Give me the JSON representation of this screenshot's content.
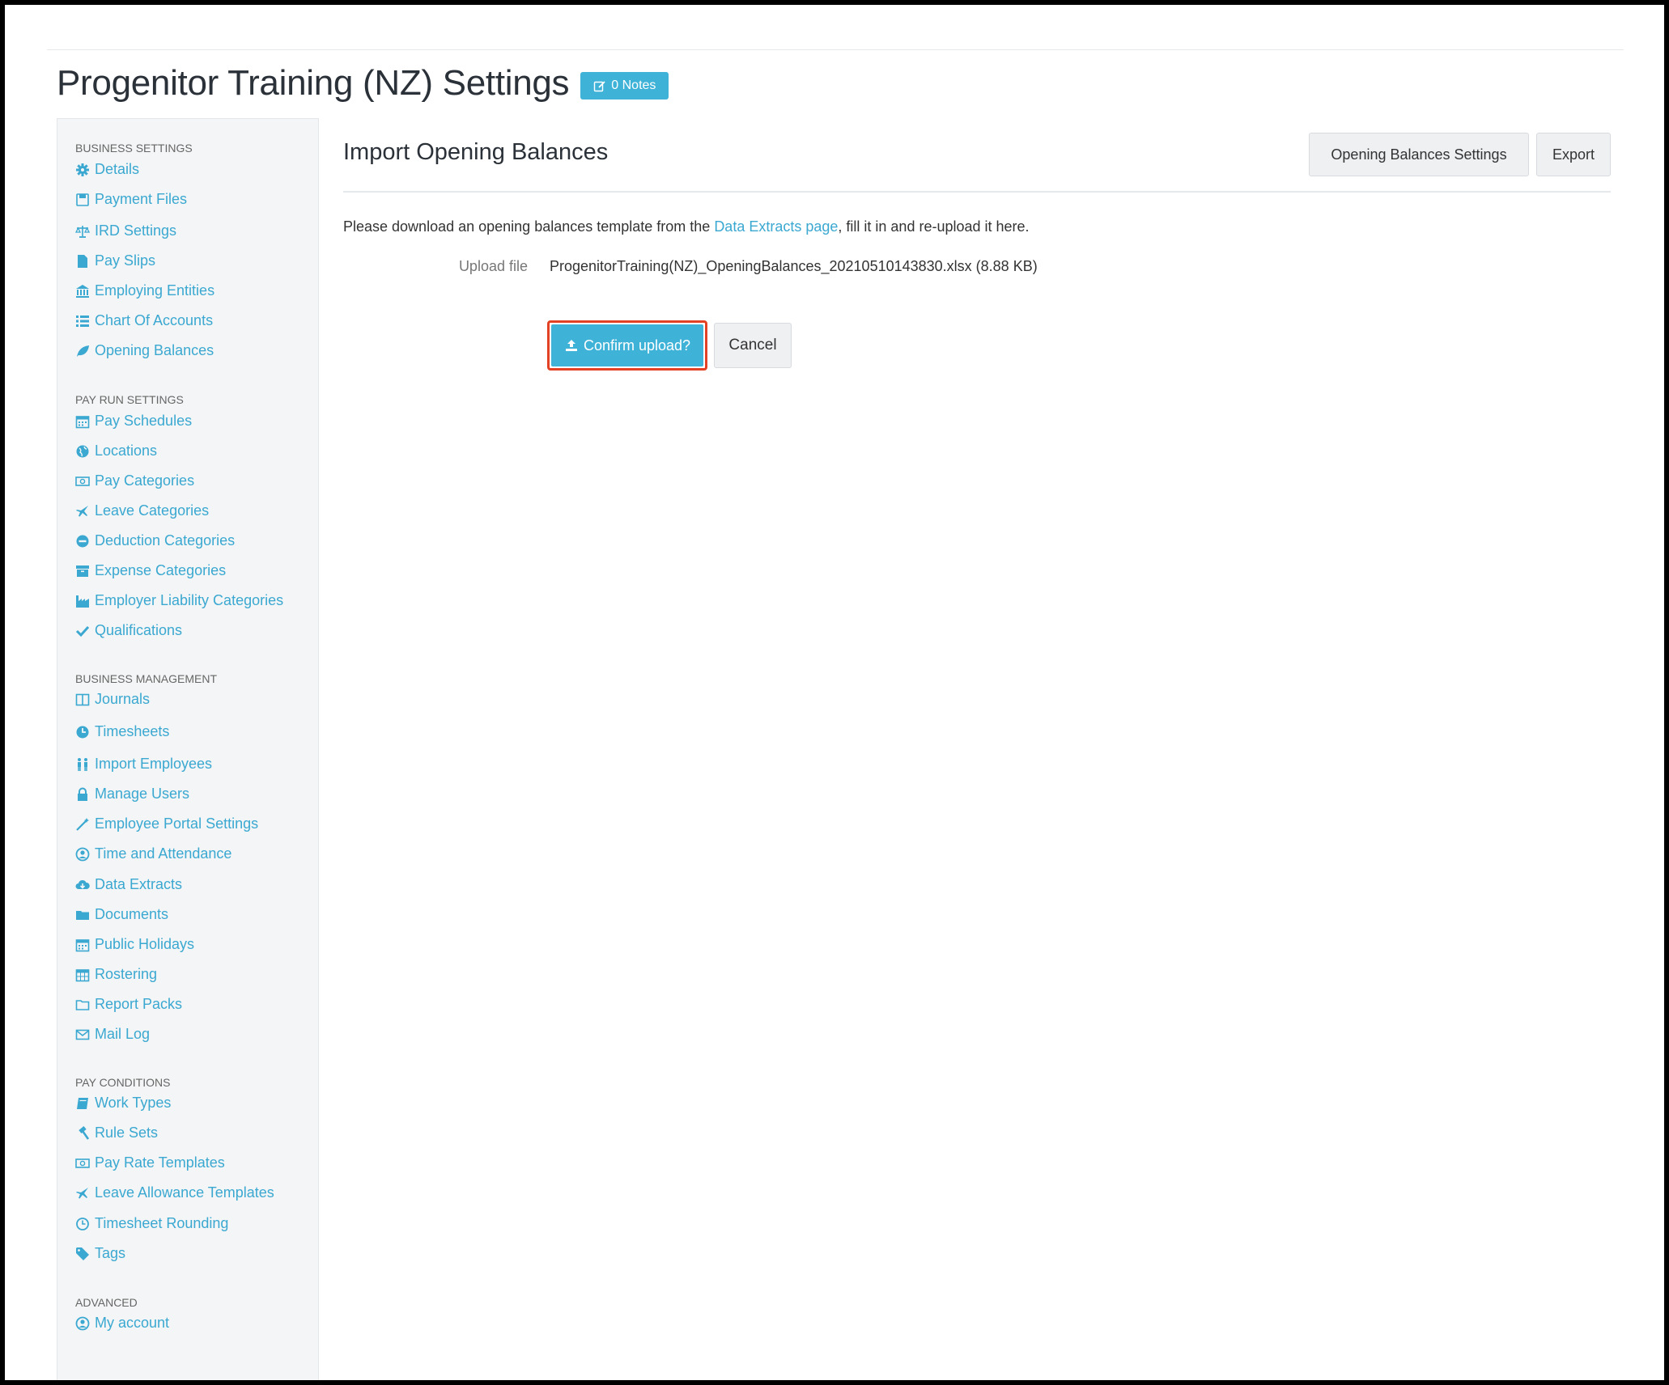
{
  "header": {
    "title": "Progenitor Training (NZ) Settings",
    "notes_label": "0 Notes"
  },
  "sidebar": {
    "business_settings": {
      "heading": "BUSINESS SETTINGS",
      "items": [
        {
          "label": "Details",
          "icon": "gear-icon"
        },
        {
          "label": "Payment Files",
          "icon": "floppy-icon"
        },
        {
          "label": "IRD Settings",
          "icon": "scale-icon"
        },
        {
          "label": "Pay Slips",
          "icon": "file-icon"
        },
        {
          "label": "Employing Entities",
          "icon": "bank-icon"
        },
        {
          "label": "Chart Of Accounts",
          "icon": "list-icon"
        },
        {
          "label": "Opening Balances",
          "icon": "leaf-icon"
        }
      ]
    },
    "pay_run_settings": {
      "heading": "PAY RUN SETTINGS",
      "items": [
        {
          "label": "Pay Schedules",
          "icon": "calendar-icon"
        },
        {
          "label": "Locations",
          "icon": "globe-icon"
        },
        {
          "label": "Pay Categories",
          "icon": "money-icon"
        },
        {
          "label": "Leave Categories",
          "icon": "plane-icon"
        },
        {
          "label": "Deduction Categories",
          "icon": "minus-circle-icon"
        },
        {
          "label": "Expense Categories",
          "icon": "archive-icon"
        },
        {
          "label": "Employer Liability Categories",
          "icon": "industry-icon"
        },
        {
          "label": "Qualifications",
          "icon": "check-icon"
        }
      ]
    },
    "business_management": {
      "heading": "BUSINESS MANAGEMENT",
      "items": [
        {
          "label": "Journals",
          "icon": "columns-icon"
        },
        {
          "label": "Timesheets",
          "icon": "clock-icon"
        },
        {
          "label": "Import Employees",
          "icon": "users-icon"
        },
        {
          "label": "Manage Users",
          "icon": "lock-icon"
        },
        {
          "label": "Employee Portal Settings",
          "icon": "magic-wand-icon"
        },
        {
          "label": "Time and Attendance",
          "icon": "user-circle-icon"
        },
        {
          "label": "Data Extracts",
          "icon": "cloud-download-icon"
        },
        {
          "label": "Documents",
          "icon": "folder-icon"
        },
        {
          "label": "Public Holidays",
          "icon": "calendar-icon"
        },
        {
          "label": "Rostering",
          "icon": "calendar-grid-icon"
        },
        {
          "label": "Report Packs",
          "icon": "folder-outline-icon"
        },
        {
          "label": "Mail Log",
          "icon": "envelope-icon"
        }
      ]
    },
    "pay_conditions": {
      "heading": "PAY CONDITIONS",
      "items": [
        {
          "label": "Work Types",
          "icon": "book-icon"
        },
        {
          "label": "Rule Sets",
          "icon": "gavel-icon"
        },
        {
          "label": "Pay Rate Templates",
          "icon": "money-icon"
        },
        {
          "label": "Leave Allowance Templates",
          "icon": "plane-icon"
        },
        {
          "label": "Timesheet Rounding",
          "icon": "clock-outline-icon"
        },
        {
          "label": "Tags",
          "icon": "tag-icon"
        }
      ]
    },
    "advanced": {
      "heading": "ADVANCED",
      "items": [
        {
          "label": "My account",
          "icon": "user-circle-icon"
        }
      ]
    }
  },
  "main": {
    "section_title": "Import Opening Balances",
    "buttons": {
      "opening_balances_settings": "Opening Balances Settings",
      "export": "Export"
    },
    "intro": {
      "before": "Please download an opening balances template from the ",
      "link": "Data Extracts page",
      "after": ", fill it in and re-upload it here."
    },
    "upload": {
      "label": "Upload file",
      "value": "ProgenitorTraining(NZ)_OpeningBalances_20210510143830.xlsx (8.88 KB)"
    },
    "confirm_label": "Confirm upload?",
    "cancel_label": "Cancel"
  },
  "colors": {
    "accent": "#3fb2d8",
    "link": "#3aa8d1",
    "highlight": "#e34124",
    "sidebar_bg": "#f4f5f6"
  }
}
